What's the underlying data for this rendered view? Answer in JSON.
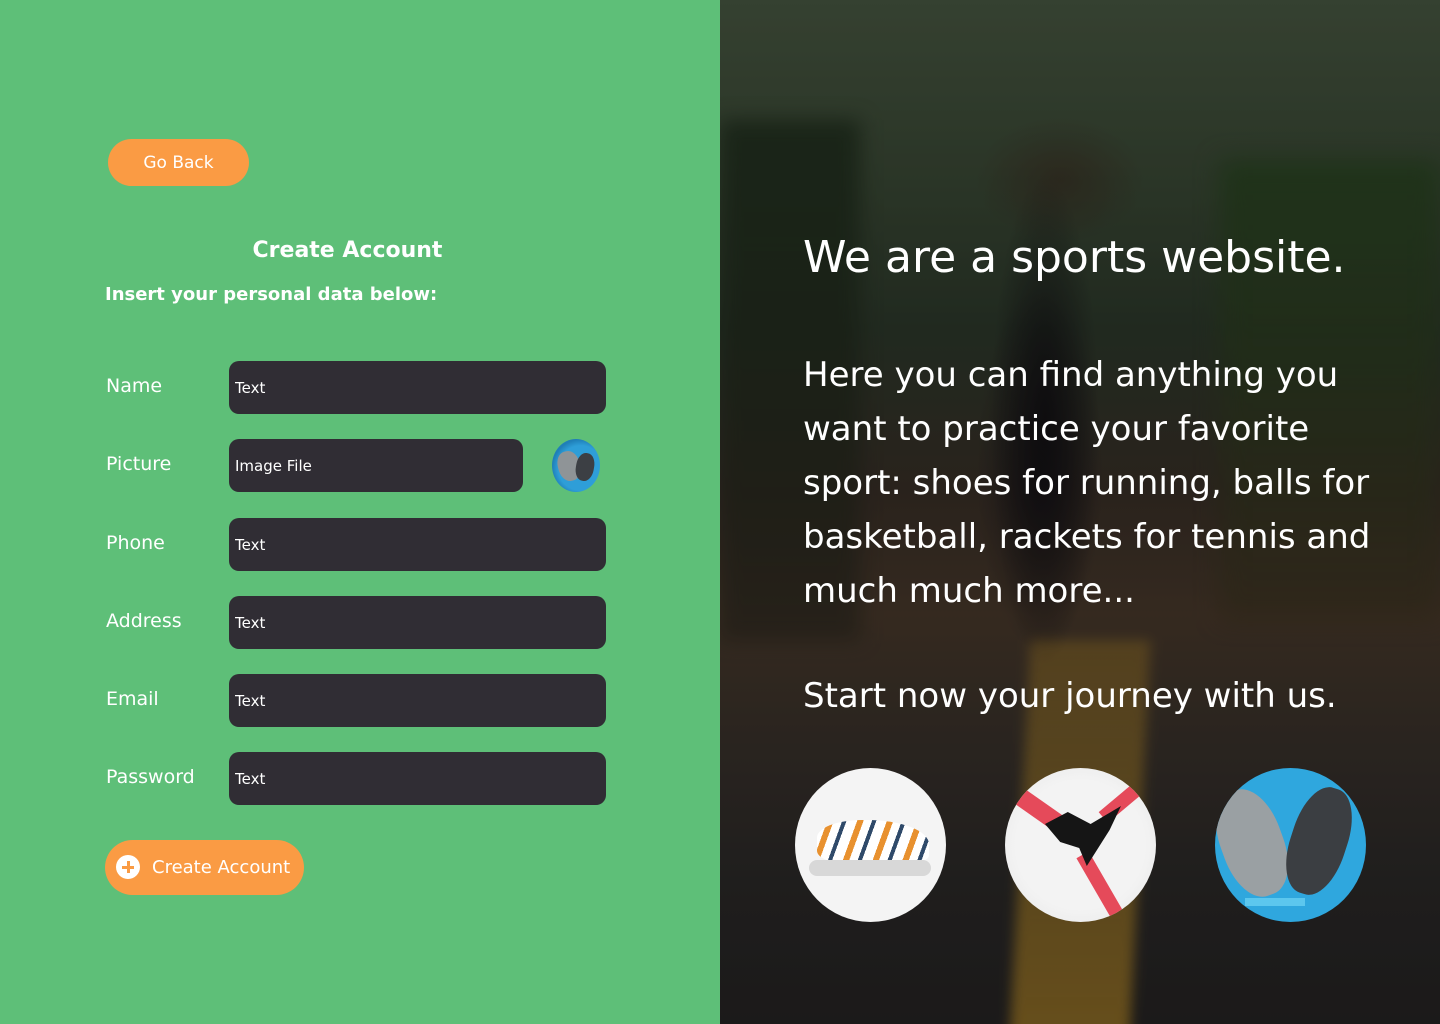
{
  "actions": {
    "go_back_label": "Go Back",
    "create_account_label": "Create Account"
  },
  "form": {
    "title": "Create Account",
    "subtitle": "Insert your personal data below:",
    "fields": {
      "name": {
        "label": "Name",
        "placeholder": "Text"
      },
      "picture": {
        "label": "Picture",
        "placeholder": "Image File"
      },
      "phone": {
        "label": "Phone",
        "placeholder": "Text"
      },
      "address": {
        "label": "Address",
        "placeholder": "Text"
      },
      "email": {
        "label": "Email",
        "placeholder": "Text"
      },
      "password": {
        "label": "Password",
        "placeholder": "Text"
      }
    }
  },
  "hero": {
    "headline": "We are a sports website.",
    "body": "Here you can find anything you want to practice your favorite sport: shoes for running, balls for basketball, rackets for tennis and much much more...",
    "cta": "Start now your journey with us."
  },
  "colors": {
    "left_background": "#5ebf78",
    "accent": "#fa9b44",
    "input_background": "#302d34",
    "text": "#ffffff"
  },
  "icons": {
    "create_account": "plus-circle-icon"
  }
}
